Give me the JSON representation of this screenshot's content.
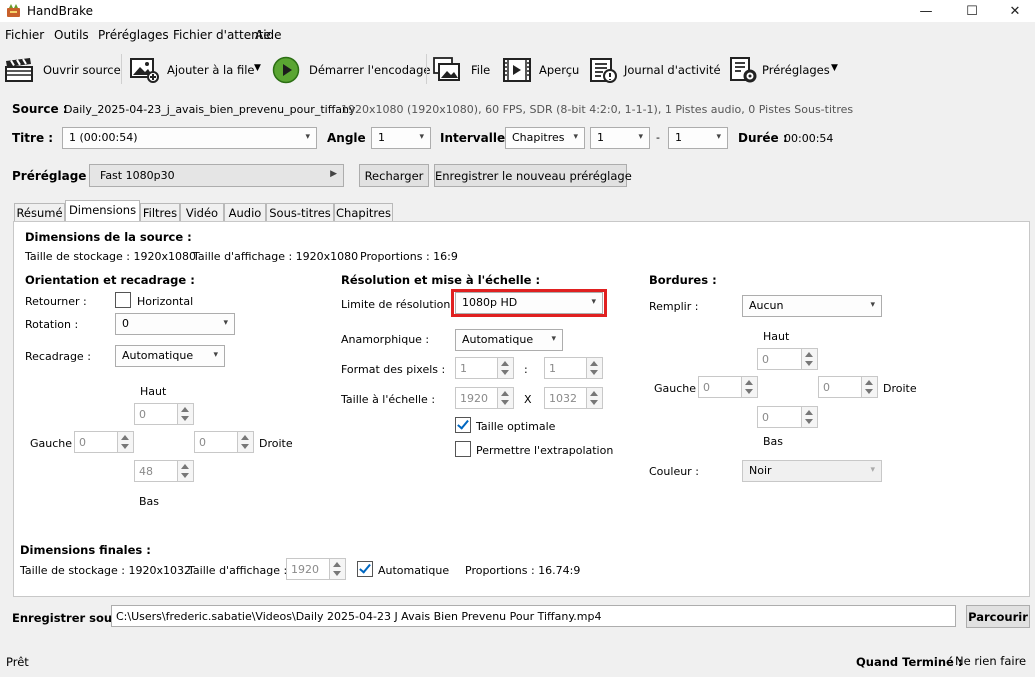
{
  "window": {
    "title": "HandBrake",
    "minimize": "—",
    "maximize": "☐",
    "close": "✕"
  },
  "menu": [
    "Fichier",
    "Outils",
    "Préréglages",
    "Fichier d'attente",
    "Aide"
  ],
  "toolbar": {
    "open_source": "Ouvrir source",
    "add_queue": "Ajouter à la file",
    "start_encode": "Démarrer l'encodage",
    "queue": "File",
    "preview": "Aperçu",
    "activity_log": "Journal d'activité",
    "presets": "Préréglages"
  },
  "source": {
    "label": "Source :",
    "name": "Daily_2025-04-23_j_avais_bien_prevenu_pour_tiffany",
    "info": "1920x1080 (1920x1080), 60 FPS, SDR (8-bit 4:2:0, 1-1-1), 1 Pistes audio, 0 Pistes Sous-titres"
  },
  "title_row": {
    "title_label": "Titre :",
    "title_value": "1  (00:00:54)",
    "angle_label": "Angle :",
    "angle_value": "1",
    "range_label": "Intervalle :",
    "range_type": "Chapitres",
    "range_start": "1",
    "range_dash": "-",
    "range_end": "1",
    "duration_label": "Durée :",
    "duration_value": "00:00:54"
  },
  "preset": {
    "label": "Préréglage :",
    "value": "Fast 1080p30",
    "reload": "Recharger",
    "save_new": "Enregistrer le nouveau préréglage"
  },
  "tabs": [
    "Résumé",
    "Dimensions",
    "Filtres",
    "Vidéo",
    "Audio",
    "Sous-titres",
    "Chapitres"
  ],
  "dimensions": {
    "source_heading": "Dimensions de la source :",
    "storage_size": "Taille de stockage : 1920x1080",
    "display_size": "Taille d'affichage : 1920x1080",
    "aspect": "Proportions : 16:9",
    "orientation": {
      "heading": "Orientation et recadrage :",
      "flip_label": "Retourner :",
      "flip_option": "Horizontal",
      "rotation_label": "Rotation :",
      "rotation_value": "0",
      "crop_label": "Recadrage :",
      "crop_value": "Automatique",
      "top_label": "Haut",
      "top_value": "0",
      "left_label": "Gauche",
      "left_value": "0",
      "right_value": "0",
      "right_label": "Droite",
      "bottom_value": "48",
      "bottom_label": "Bas"
    },
    "resolution": {
      "heading": "Résolution et mise à l'échelle :",
      "limit_label": "Limite de résolution :",
      "limit_value": "1080p HD",
      "anamorphic_label": "Anamorphique :",
      "anamorphic_value": "Automatique",
      "pixel_format_label": "Format des pixels :",
      "pixel_w": "1",
      "pixel_sep": ":",
      "pixel_h": "1",
      "scale_label": "Taille à l'échelle :",
      "scale_w": "1920",
      "scale_sep": "X",
      "scale_h": "1032",
      "optimal_label": "Taille optimale",
      "upscale_label": "Permettre l'extrapolation"
    },
    "borders": {
      "heading": "Bordures :",
      "fill_label": "Remplir :",
      "fill_value": "Aucun",
      "top_label": "Haut",
      "top_value": "0",
      "left_label": "Gauche",
      "left_value": "0",
      "right_value": "0",
      "right_label": "Droite",
      "bottom_value": "0",
      "bottom_label": "Bas",
      "color_label": "Couleur :",
      "color_value": "Noir"
    },
    "final": {
      "heading": "Dimensions finales :",
      "storage": "Taille de stockage : 1920x1032",
      "display_label": "Taille d'affichage :",
      "display_value": "1920",
      "auto_label": "Automatique",
      "aspect": "Proportions : 16.74:9"
    }
  },
  "save": {
    "label": "Enregistrer sous :",
    "path": "C:\\Users\\frederic.sabatie\\Videos\\Daily 2025-04-23 J Avais Bien Prevenu Pour Tiffany.mp4",
    "browse": "Parcourir"
  },
  "status": {
    "text": "Prêt",
    "when_done_label": "Quand Terminé :",
    "when_done_value": "Ne rien faire"
  }
}
